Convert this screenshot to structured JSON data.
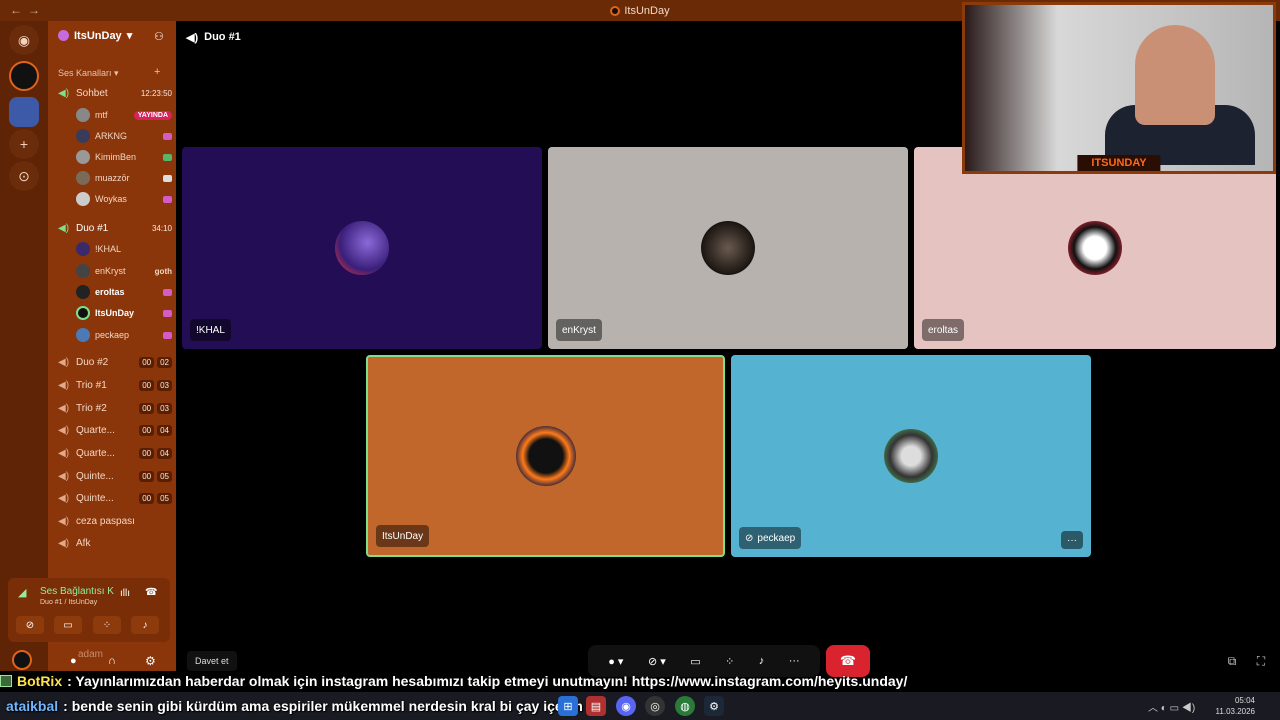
{
  "window": {
    "title": "ItsUnDay",
    "nav": "←→"
  },
  "server": {
    "name": "ItsUnDay",
    "section": "Ses Kanalları",
    "channels": [
      {
        "name": "Sohbet",
        "timer": "12:23:50"
      },
      {
        "name": "Duo #1",
        "timer": "34:10"
      },
      {
        "name": "Duo #2",
        "counts": [
          "00",
          "02"
        ]
      },
      {
        "name": "Trio #1",
        "counts": [
          "00",
          "03"
        ]
      },
      {
        "name": "Trio #2",
        "counts": [
          "00",
          "03"
        ]
      },
      {
        "name": "Quarte...",
        "counts": [
          "00",
          "04"
        ]
      },
      {
        "name": "Quarte...",
        "counts": [
          "00",
          "04"
        ]
      },
      {
        "name": "Quinte...",
        "counts": [
          "00",
          "05"
        ]
      },
      {
        "name": "Quinte...",
        "counts": [
          "00",
          "05"
        ]
      },
      {
        "name": "ceza paspası"
      },
      {
        "name": "Afk"
      }
    ],
    "sohbet_users": [
      {
        "name": "mtf",
        "badge": "YAYINDA"
      },
      {
        "name": "ARKNG"
      },
      {
        "name": "KimimBen"
      },
      {
        "name": "muazzōr"
      },
      {
        "name": "Woykas"
      }
    ],
    "duo_users": [
      {
        "name": "!KHAL"
      },
      {
        "name": "enKryst",
        "extra": "goth"
      },
      {
        "name": "eroltas"
      },
      {
        "name": "ItsUnDay"
      },
      {
        "name": "peckaep"
      }
    ]
  },
  "voice_panel": {
    "status": "Ses Bağlantısı K",
    "location": "Duo #1 / ItsUnDay",
    "user": "adam"
  },
  "main": {
    "channel": "Duo #1",
    "tiles": [
      {
        "label": "!KHAL",
        "bg": "#230d55"
      },
      {
        "label": "enKryst",
        "bg": "#b7b2ae"
      },
      {
        "label": "eroltas",
        "bg": "#e5c3c1"
      },
      {
        "label": "ItsUnDay",
        "bg": "#c2672c"
      },
      {
        "label": "peckaep",
        "bg": "#55b2d0"
      }
    ],
    "invite": "Davet et",
    "webcam_brand": "ITSUNDAY"
  },
  "chat": [
    {
      "user": "BotRix",
      "color": "#ffe34a",
      "text": ": Yayınlarımızdan haberdar olmak için instagram hesabımızı takip etmeyi unutmayın! https://www.instagram.com/heyits.unday/"
    },
    {
      "user": "ataikbal",
      "color": "#6fb7ff",
      "text": ": bende senin gibi kürdüm ama espiriler mükemmel nerdesin kral bi çay içelim"
    }
  ],
  "taskbar": {
    "time": "05:04",
    "date": "11.03.2026"
  },
  "colors": {
    "accent": "#e0631a",
    "sidebar": "#8a360a",
    "leave": "#d9242f"
  }
}
